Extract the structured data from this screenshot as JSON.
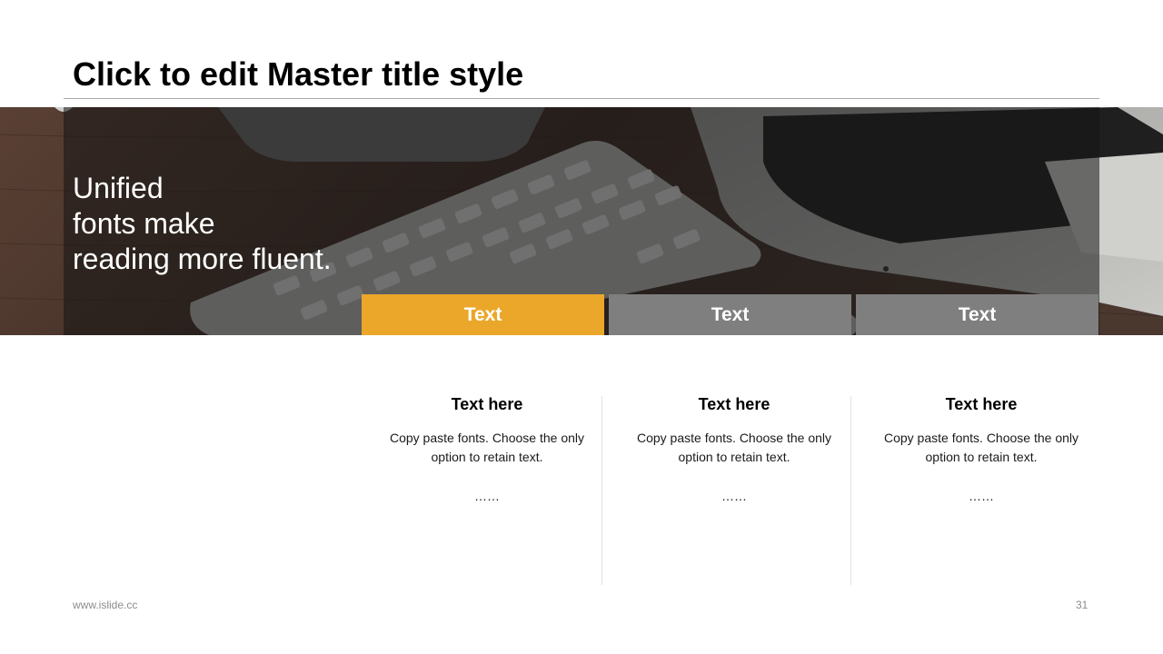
{
  "slide": {
    "title": "Click to edit Master title style",
    "banner_lines": [
      "Unified",
      "fonts make",
      "reading more fluent."
    ]
  },
  "tabs": [
    {
      "label": "Text",
      "active": true
    },
    {
      "label": "Text",
      "active": false
    },
    {
      "label": "Text",
      "active": false
    }
  ],
  "columns": [
    {
      "heading": "Text here",
      "body": "Copy paste fonts. Choose the only option to retain text.",
      "ellipsis": "……"
    },
    {
      "heading": "Text here",
      "body": "Copy paste fonts. Choose the only option to retain text.",
      "ellipsis": "……"
    },
    {
      "heading": "Text here",
      "body": "Copy paste fonts. Choose the only option to retain text.",
      "ellipsis": "……"
    }
  ],
  "footer": {
    "website": "www.islide.cc",
    "page_number": "31"
  },
  "colors": {
    "accent": "#eba72a",
    "inactive_tab": "#7f7f7f"
  }
}
